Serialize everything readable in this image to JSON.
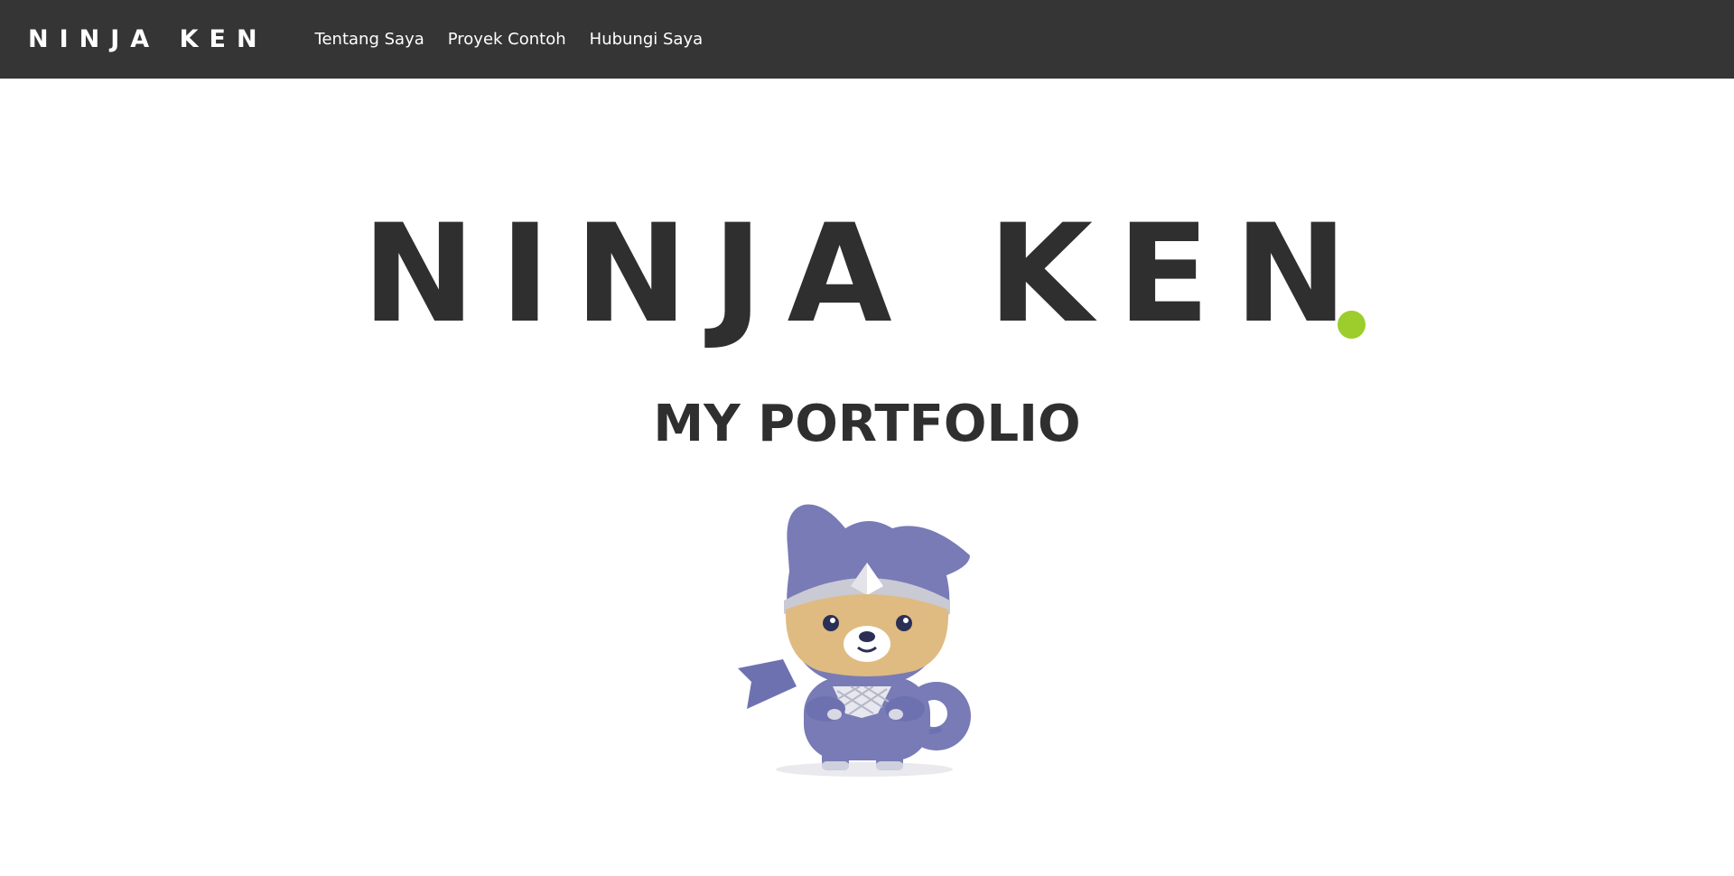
{
  "navbar": {
    "brand": "NINJA KEN",
    "links": [
      {
        "label": "Tentang Saya"
      },
      {
        "label": "Proyek Contoh"
      },
      {
        "label": "Hubungi Saya"
      }
    ]
  },
  "hero": {
    "title": "NINJA KEN",
    "subtitle": "MY PORTFOLIO",
    "mascot_icon": "ninja-dog-mascot"
  },
  "colors": {
    "navbar_bg": "#353535",
    "text_dark": "#2f2f2f",
    "accent_dot": "#9ccd2c",
    "mascot_purple": "#787bb6",
    "mascot_face": "#dfbb82"
  }
}
